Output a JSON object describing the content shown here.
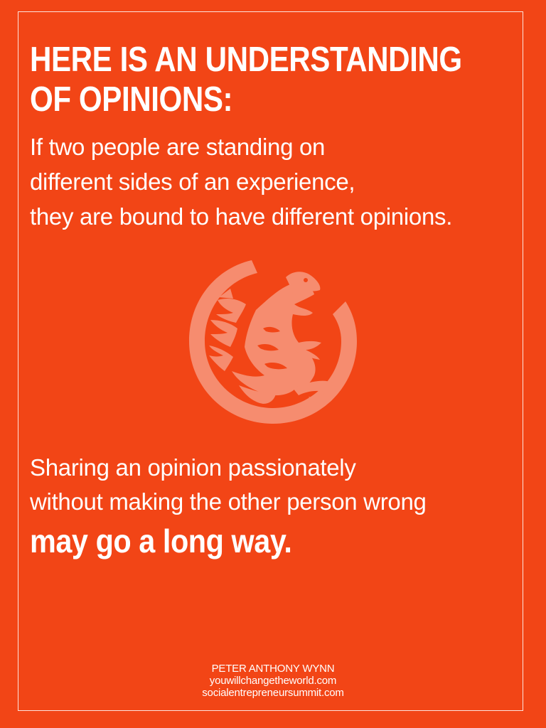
{
  "poster": {
    "background_color": "#f24516",
    "text_color": "#ffffff",
    "emblem_color": "#f68c6f",
    "headline": {
      "line1": "HERE IS AN UNDERSTANDING",
      "line2": "OF OPINIONS:"
    },
    "intro": {
      "line1": "If two people are standing on",
      "line2": "different sides of an experience,",
      "line3": "they are bound to have different opinions."
    },
    "emblem_icon": "griffin-emblem-icon",
    "closing": {
      "line1": "Sharing an opinion passionately",
      "line2": "without making the other person wrong",
      "line3": "may go a long way."
    },
    "credits": {
      "author": "PETER ANTHONY WYNN",
      "site1": "youwillchangetheworld.com",
      "site2": "socialentrepreneursummit.com"
    }
  }
}
